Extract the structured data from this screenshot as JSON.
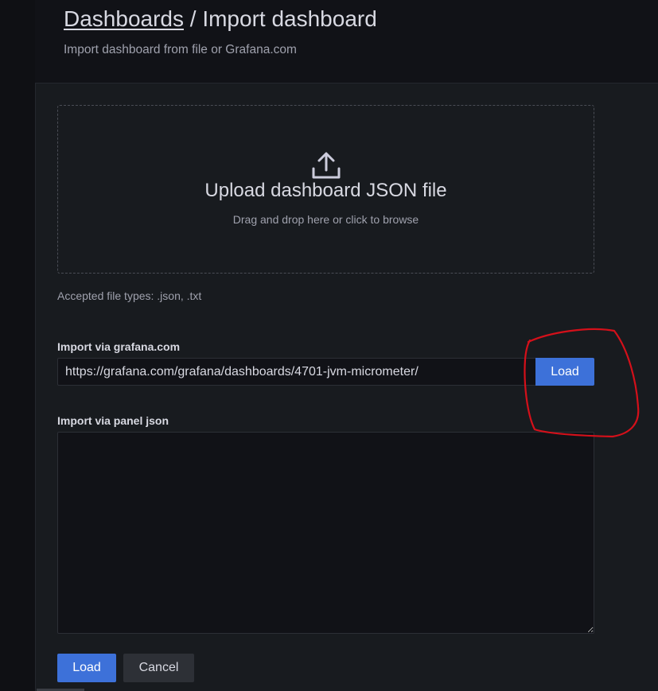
{
  "header": {
    "breadcrumb_link": "Dashboards",
    "breadcrumb_separator": " / ",
    "title": "Import dashboard",
    "subtitle": "Import dashboard from file or Grafana.com"
  },
  "upload": {
    "icon": "upload-icon",
    "title": "Upload dashboard JSON file",
    "hint": "Drag and drop here or click to browse",
    "accepted_types": "Accepted file types: .json, .txt"
  },
  "grafana_import": {
    "label": "Import via grafana.com",
    "url_value": "https://grafana.com/grafana/dashboards/4701-jvm-micrometer/",
    "load_label": "Load"
  },
  "panel_json": {
    "label": "Import via panel json",
    "value": ""
  },
  "actions": {
    "load_label": "Load",
    "cancel_label": "Cancel"
  },
  "colors": {
    "primary": "#3d71d9",
    "annotation": "#d4101a",
    "background": "#111217",
    "panel": "#181b1f"
  }
}
